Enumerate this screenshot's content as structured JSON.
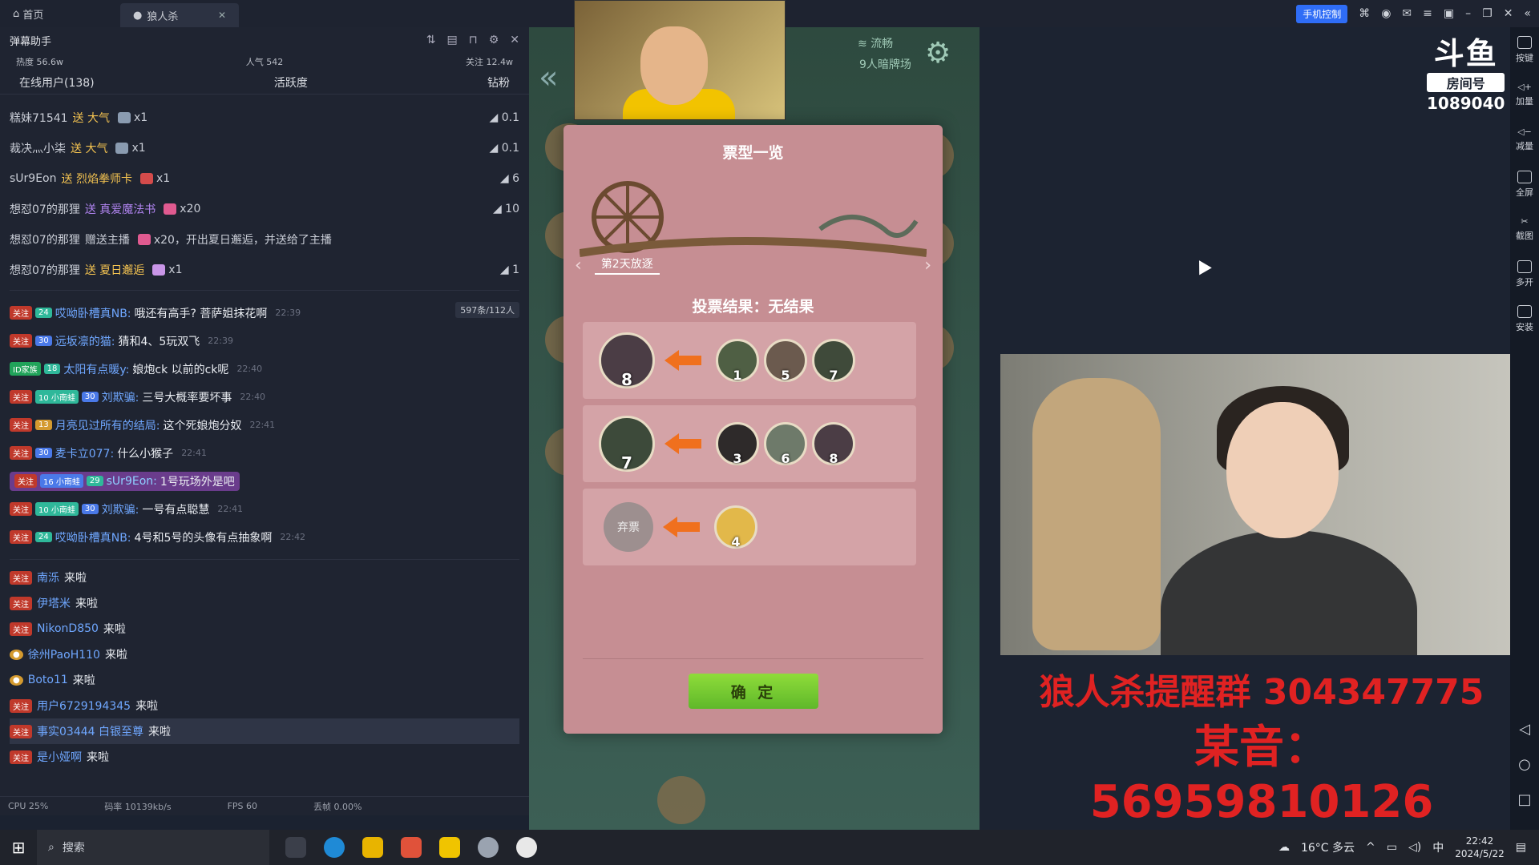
{
  "tabs": [
    {
      "label": "首页"
    },
    {
      "label": "狼人杀"
    }
  ],
  "topbar": {
    "phone_control": "手机控制"
  },
  "panel": {
    "title": "弹幕助手",
    "stats": {
      "heat": "热度 56.6w",
      "popularity": "人气 542",
      "follow": "关注 12.4w"
    },
    "subtabs": [
      "在线用户(138)",
      "活跃度",
      "钻粉"
    ],
    "gifts": [
      {
        "user": "糕妹71541",
        "action": "送 大气",
        "qty": "x1",
        "value": "0.1"
      },
      {
        "user": "裁决灬小柒",
        "action": "送 大气",
        "qty": "x1",
        "value": "0.1"
      },
      {
        "user": "sUr9Eon",
        "action": "送 烈焰拳师卡",
        "qty": "x1",
        "value": "6"
      },
      {
        "user": "想怼07的那狸",
        "action": "送 真爱魔法书",
        "qty": "x20",
        "value": "10"
      },
      {
        "user": "想怼07的那狸",
        "action": "赠送主播",
        "qty": "x20，开出夏日邂逅，并送给了主播",
        "value": ""
      },
      {
        "user": "想怼07的那狸",
        "action": "送 夏日邂逅",
        "qty": "x1",
        "value": "1"
      }
    ],
    "count_badge": "597条/112人",
    "chats": [
      {
        "badges": [
          "关注",
          "24"
        ],
        "user": "哎呦卧槽真NB:",
        "text": "哦还有高手? 菩萨姐抹花啊",
        "time": "22:39"
      },
      {
        "badges": [
          "关注",
          "30"
        ],
        "user": "远坂凛的猫:",
        "text": "猜和4、5玩双飞",
        "time": "22:39"
      },
      {
        "badges": [
          "ID家族",
          "18"
        ],
        "user": "太阳有点暖y:",
        "text": "娘炮ck 以前的ck呢",
        "time": "22:40"
      },
      {
        "badges": [
          "关注",
          "10 小南蛙",
          "30"
        ],
        "user": "刘欺骗:",
        "text": "三号大概率要坏事",
        "time": "22:40"
      },
      {
        "badges": [
          "关注",
          "13"
        ],
        "user": "月亮见过所有的结局:",
        "text": "这个死娘炮分奴",
        "time": "22:41"
      },
      {
        "badges": [
          "关注",
          "30"
        ],
        "user": "麦卡立077:",
        "text": "什么小猴子",
        "time": "22:41"
      },
      {
        "badges": [
          "关注",
          "16 小南蛙",
          "29"
        ],
        "user": "sUr9Eon:",
        "text": "1号玩场外是吧",
        "time": "",
        "highlight": true
      },
      {
        "badges": [
          "关注",
          "10 小南蛙",
          "30"
        ],
        "user": "刘欺骗:",
        "text": "一号有点聪慧",
        "time": "22:41"
      },
      {
        "badges": [
          "关注",
          "24"
        ],
        "user": "哎呦卧槽真NB:",
        "text": "4号和5号的头像有点抽象啊",
        "time": "22:42"
      }
    ],
    "enters": [
      {
        "user": "南泺",
        "text": "来啦"
      },
      {
        "user": "伊塔米",
        "text": "来啦"
      },
      {
        "user": "NikonD850",
        "text": "来啦"
      },
      {
        "user": "徐州PaoH110",
        "text": "来啦"
      },
      {
        "user": "Boto11",
        "text": "来啦"
      },
      {
        "user": "用户6729194345",
        "text": "来啦"
      },
      {
        "user": "事实03444 白银至尊",
        "text": "来啦"
      },
      {
        "user": "是小娅啊",
        "text": "来啦"
      }
    ],
    "footer": {
      "cpu": "CPU 25%",
      "bitrate": "码率 10139kb/s",
      "fps": "FPS 60",
      "drop": "丢帧 0.00%"
    }
  },
  "game": {
    "status": "流畅",
    "mode": "9人暗牌场"
  },
  "modal": {
    "title": "票型一览",
    "day_label": "第2天放逐",
    "result": "投票结果：无结果",
    "rows": [
      {
        "target": "8",
        "voters": [
          "1",
          "5",
          "7"
        ]
      },
      {
        "target": "7",
        "voters": [
          "3",
          "6",
          "8"
        ]
      },
      {
        "target": "弃票",
        "voters": [
          "4"
        ]
      }
    ],
    "confirm": "确 定"
  },
  "stream": {
    "room_label": "房间号",
    "room_id": "1089040",
    "overlay_line1": "狼人杀提醒群 304347775",
    "overlay_line2": "某音：  56959810126"
  },
  "sidebar": [
    "按键",
    "加量",
    "减量",
    "全屏",
    "截图",
    "多开",
    "安装"
  ],
  "taskbar": {
    "search": "搜索",
    "weather": "16°C 多云",
    "time": "22:42",
    "date": "2024/5/22"
  },
  "colors": {
    "accent": "#f5c451",
    "username": "#6fa7ff",
    "overlay_red": "#e02222",
    "confirm_green": "#8fdc3a"
  }
}
